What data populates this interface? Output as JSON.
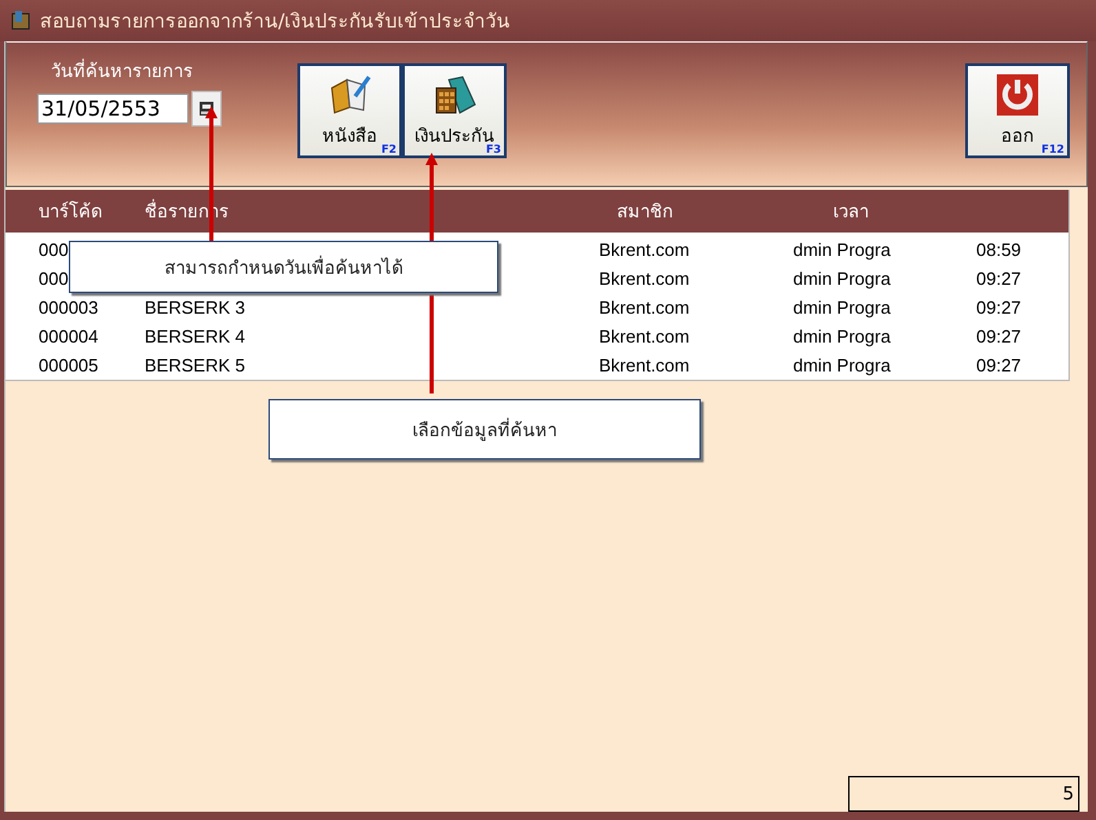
{
  "window": {
    "title": "สอบถามรายการออกจากร้าน/เงินประกันรับเข้าประจำวัน"
  },
  "search": {
    "label": "วันที่ค้นหารายการ",
    "value": "31/05/2553"
  },
  "buttons": [
    {
      "kind": "book",
      "label": "หนังสือ",
      "key": "F2"
    },
    {
      "kind": "deposit",
      "label": "เงินประกัน",
      "key": "F3"
    },
    {
      "kind": "exit",
      "label": "ออก",
      "key": "F12"
    }
  ],
  "table": {
    "columns": [
      "บาร์โค้ด",
      "ชื่อรายการ",
      "สมาชิก",
      "เวลา"
    ],
    "rows": [
      {
        "barcode": "000",
        "member": "Bkrent.com",
        "staff": "dmin Progra",
        "time": "08:59"
      },
      {
        "barcode": "000",
        "member": "Bkrent.com",
        "staff": "dmin Progra",
        "time": "09:27"
      },
      {
        "barcode": "000003",
        "name": "BERSERK 3",
        "member": "Bkrent.com",
        "staff": "dmin Progra",
        "time": "09:27"
      },
      {
        "barcode": "000004",
        "name": "BERSERK 4",
        "member": "Bkrent.com",
        "staff": "dmin Progra",
        "time": "09:27"
      },
      {
        "barcode": "000005",
        "name": "BERSERK 5",
        "member": "Bkrent.com",
        "staff": "dmin Progra",
        "time": "09:27"
      }
    ]
  },
  "callouts": [
    {
      "text": "สามารถกำหนดวันเพื่อค้นหาได้"
    },
    {
      "text": "เลือกข้อมูลที่ค้นหา"
    }
  ],
  "status_bar": {
    "count": "5"
  }
}
